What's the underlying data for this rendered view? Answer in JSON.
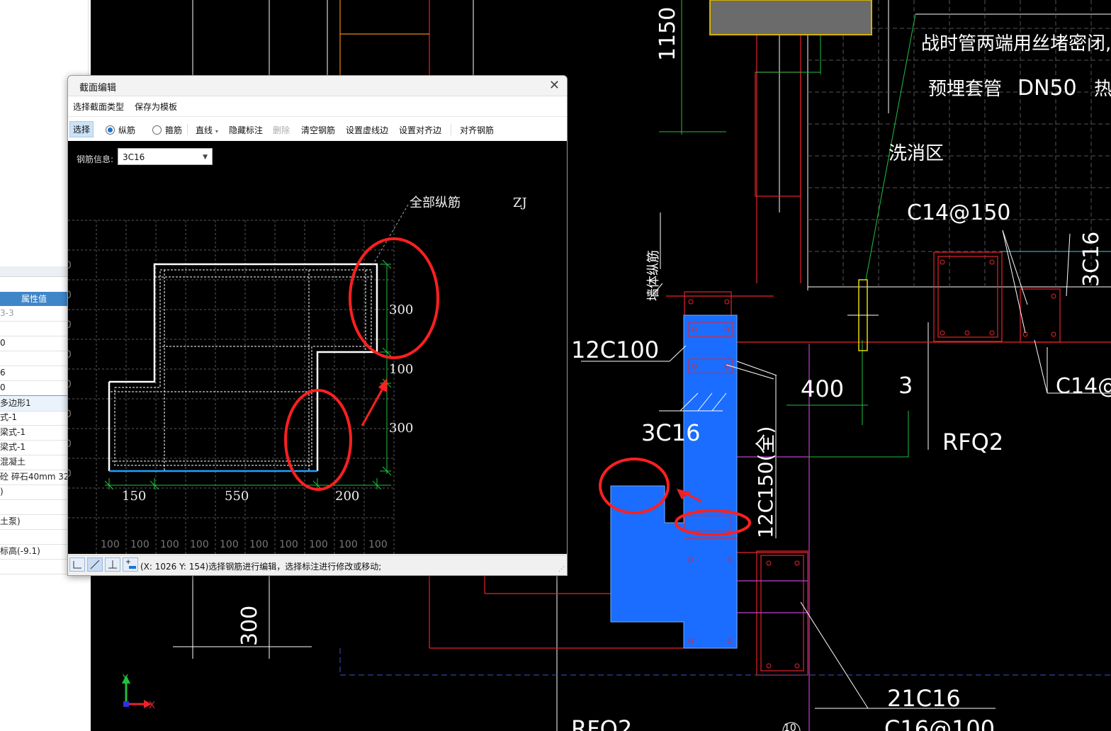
{
  "left_panel": {
    "header": "属性值",
    "rows": [
      {
        "text": "3-3",
        "gray": true
      },
      {
        "text": "",
        "gray": false
      },
      {
        "text": "0",
        "gray": false
      },
      {
        "text": "",
        "gray": false
      },
      {
        "text": "6",
        "gray": false
      },
      {
        "text": "0",
        "gray": false
      },
      {
        "text": "多边形1",
        "gray": false,
        "selected": true
      },
      {
        "text": "式-1",
        "gray": false
      },
      {
        "text": "梁式-1",
        "gray": false
      },
      {
        "text": "梁式-1",
        "gray": false
      },
      {
        "text": "混凝土",
        "gray": false
      },
      {
        "text": "砼 碎石40mm 32",
        "gray": false
      },
      {
        "text": ")",
        "gray": false
      },
      {
        "text": "",
        "gray": false
      },
      {
        "text": "土泵)",
        "gray": false
      },
      {
        "text": "",
        "gray": false
      },
      {
        "text": "标高(-9.1)",
        "gray": false
      }
    ]
  },
  "cad": {
    "texts": {
      "t1150": "1150",
      "note1": "战时管两端用丝堵密闭,",
      "note2": "预埋套管",
      "note3": "DN50",
      "note4": "热",
      "wash": "洗消区",
      "c14_150": "C14@150",
      "c16_right": "3C16",
      "wall_rebar": "墙体纵筋",
      "r12c100": "12C100",
      "r3c16": "3C16",
      "r12c150": "12C150(全)",
      "t400": "400",
      "t3": "3",
      "rfq2": "RFQ2",
      "c14_1": "C14@1",
      "t300": "300",
      "r21c16": "21C16",
      "c16_100": "C16@100",
      "rfq2_bottom": "RFQ2",
      "t10": "10",
      "ucs_x": "X",
      "ucs_y": "Y"
    }
  },
  "dialog": {
    "title": "截面编辑",
    "menu": {
      "select_type": "选择截面类型",
      "save_template": "保存为模板"
    },
    "toolbar": {
      "select": "选择",
      "longitudinal": "纵筋",
      "stirrup": "箍筋",
      "line": "直线",
      "hide_label": "隐藏标注",
      "delete": "删除",
      "clear_rebar": "清空钢筋",
      "set_dashed": "设置虚线边",
      "set_align": "设置对齐边",
      "align_rebar": "对齐钢筋"
    },
    "rebar_info_label": "钢筋信息:",
    "rebar_info_value": "3C16",
    "canvas": {
      "label_all": "全部纵筋",
      "label_zj": "ZJ",
      "dim_300_top": "300",
      "dim_100": "100",
      "dim_300_bottom": "300",
      "dim_150": "150",
      "dim_550": "550",
      "dim_200": "200",
      "grid_label": "100",
      "edge_label": "0"
    },
    "status": "(X: 1026 Y: 154)选择钢筋进行编辑，选择标注进行修改或移动;"
  }
}
